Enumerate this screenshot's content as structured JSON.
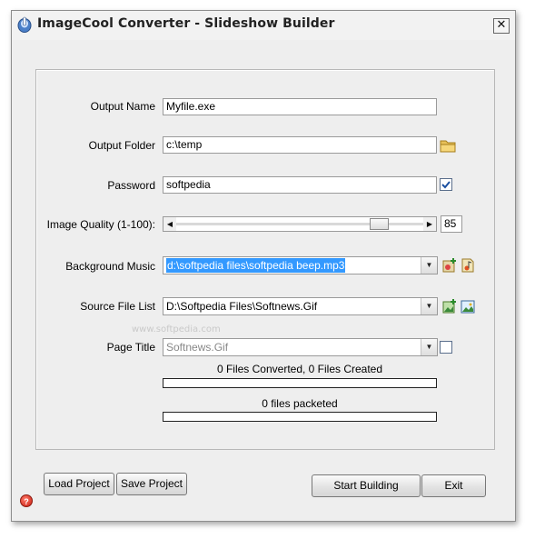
{
  "window": {
    "title": "ImageCool Converter - Slideshow Builder",
    "close_glyph": "✕"
  },
  "form": {
    "output_name": {
      "label": "Output Name",
      "value": "Myfile.exe"
    },
    "output_folder": {
      "label": "Output Folder",
      "value": "c:\\temp",
      "icon": "folder-icon"
    },
    "password": {
      "label": "Password",
      "value": "softpedia",
      "checked": true
    },
    "image_quality": {
      "label": "Image Quality (1-100):",
      "value": "85",
      "level": 0.85
    },
    "background_music": {
      "label": "Background Music",
      "value": "d:\\softpedia files\\softpedia beep.mp3",
      "icons": [
        "add-file-icon",
        "music-file-icon"
      ]
    },
    "source_file_list": {
      "label": "Source File List",
      "value": "D:\\Softpedia Files\\Softnews.Gif",
      "icons": [
        "add-image-icon",
        "image-file-icon"
      ]
    },
    "page_title": {
      "label": "Page Title",
      "value": "Softnews.Gif",
      "checked": false
    }
  },
  "status": {
    "converted": "0 Files Converted, 0 Files Created",
    "converted_progress": 0,
    "packeted": "0 files packeted",
    "packeted_progress": 0
  },
  "buttons": {
    "load_project": "Load Project",
    "save_project": "Save Project",
    "start_building": "Start Building",
    "exit": "Exit"
  },
  "watermark": "www.softpedia.com",
  "colors": {
    "selection": "#3399ff",
    "check": "#1a4fa0",
    "help": "#c81d10"
  }
}
